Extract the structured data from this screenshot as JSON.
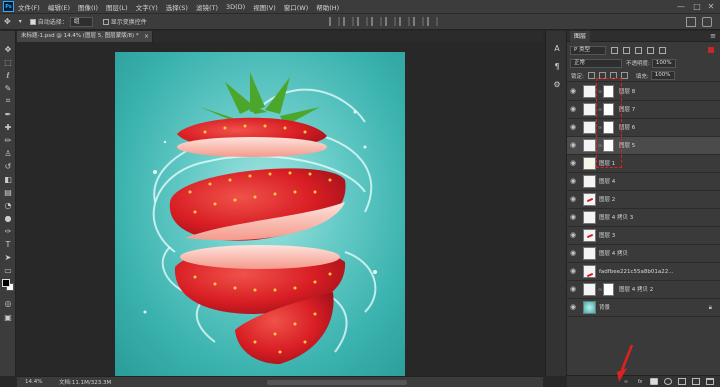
{
  "app": {
    "logo": "Ps",
    "menu": [
      "文件(F)",
      "编辑(E)",
      "图像(I)",
      "图层(L)",
      "文字(Y)",
      "选择(S)",
      "滤镜(T)",
      "3D(D)",
      "视图(V)",
      "窗口(W)",
      "帮助(H)"
    ],
    "window_controls": [
      "—",
      "□",
      "✕"
    ]
  },
  "options_bar": {
    "auto_select_label": "自动选择：",
    "auto_select_value": "组",
    "transform_label": "显示变换控件"
  },
  "document": {
    "tab_title": "未标题-1.psd @ 14.4% (图层 5, 图层蒙版/8) *",
    "zoom": "14.4%",
    "doc_info": "文档:11.1M/323.3M"
  },
  "layers_panel": {
    "title": "图层",
    "kind_filter": "P 类型",
    "blend_mode": "正常",
    "opacity_label": "不透明度:",
    "opacity_value": "100%",
    "lock_label": "锁定:",
    "fill_label": "填充:",
    "fill_value": "100%",
    "layers": [
      {
        "name": "图层 8",
        "has_mask": true,
        "selected": false
      },
      {
        "name": "图层 7",
        "has_mask": true,
        "selected": false
      },
      {
        "name": "图层 6",
        "has_mask": true,
        "selected": false
      },
      {
        "name": "图层 5",
        "has_mask": true,
        "selected": true
      },
      {
        "name": "图层 1",
        "has_mask": false,
        "selected": false
      },
      {
        "name": "图层 4",
        "has_mask": false,
        "selected": false
      },
      {
        "name": "图层 2",
        "has_mask": false,
        "selected": false
      },
      {
        "name": "图层 4 拷贝 3",
        "has_mask": false,
        "selected": false
      },
      {
        "name": "图层 3",
        "has_mask": false,
        "selected": false
      },
      {
        "name": "图层 4 拷贝",
        "has_mask": false,
        "selected": false
      },
      {
        "name": "fadfbee221c55a8b01a22...",
        "has_mask": false,
        "selected": false
      },
      {
        "name": "图层 4 拷贝 2",
        "has_mask": true,
        "selected": false
      },
      {
        "name": "背景",
        "has_mask": false,
        "selected": false
      }
    ],
    "footer_icons": [
      "fx",
      "mask-icon",
      "adjustment-icon",
      "group-icon",
      "new-layer-icon",
      "delete-icon"
    ]
  },
  "colors": {
    "accent_red": "#e02020",
    "canvas_teal": "#3ab2ae",
    "ui_dark": "#3c3c3c"
  }
}
